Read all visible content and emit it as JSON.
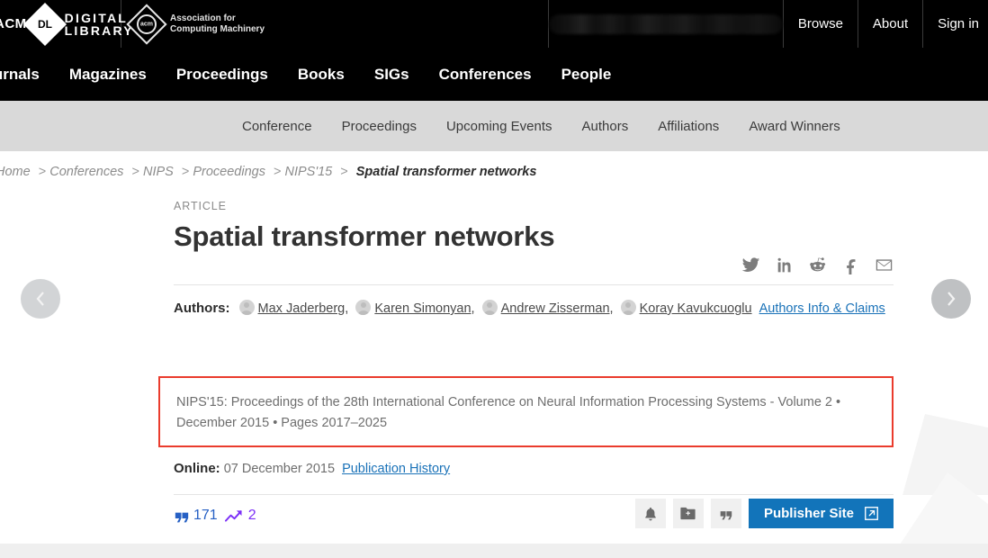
{
  "topbar": {
    "acm_prefix": "ACM",
    "dl_line1": "DIGITAL",
    "dl_line2": "LIBRARY",
    "acm_org_line1": "Association for",
    "acm_org_line2": "Computing Machinery",
    "acm_logo_label": "acm",
    "dl_logo_label": "DL",
    "search_redacted": "",
    "links": [
      {
        "label": "Browse"
      },
      {
        "label": "About"
      },
      {
        "label": "Sign in"
      }
    ]
  },
  "mainnav": {
    "items": [
      {
        "label": "Journals"
      },
      {
        "label": "Magazines"
      },
      {
        "label": "Proceedings"
      },
      {
        "label": "Books"
      },
      {
        "label": "SIGs"
      },
      {
        "label": "Conferences"
      },
      {
        "label": "People"
      }
    ]
  },
  "subnav": {
    "items": [
      {
        "label": "Conference"
      },
      {
        "label": "Proceedings"
      },
      {
        "label": "Upcoming Events"
      },
      {
        "label": "Authors"
      },
      {
        "label": "Affiliations"
      },
      {
        "label": "Award Winners"
      }
    ]
  },
  "breadcrumb": {
    "items": [
      {
        "label": "Home"
      },
      {
        "label": "Conferences"
      },
      {
        "label": "NIPS"
      },
      {
        "label": "Proceedings"
      },
      {
        "label": "NIPS'15"
      }
    ],
    "separator": ">",
    "current": "Spatial transformer networks"
  },
  "article": {
    "kicker": "ARTICLE",
    "title": "Spatial transformer networks",
    "authors_label": "Authors:",
    "authors": [
      {
        "name": "Max Jaderberg",
        "suffix": ","
      },
      {
        "name": "Karen Simonyan",
        "suffix": ","
      },
      {
        "name": "Andrew Zisserman",
        "suffix": ","
      },
      {
        "name": "Koray Kavukcuoglu",
        "suffix": ""
      }
    ],
    "authors_info_link": "Authors Info & Claims",
    "publication_info": "NIPS'15: Proceedings of the 28th International Conference on Neural Information Processing Systems - Volume 2 • December 2015  • Pages 2017–2025",
    "online_label": "Online:",
    "online_date": "07 December 2015",
    "publication_history_link": "Publication History"
  },
  "share": {
    "icons": [
      {
        "name": "twitter-icon"
      },
      {
        "name": "linkedin-icon"
      },
      {
        "name": "reddit-icon"
      },
      {
        "name": "facebook-icon"
      },
      {
        "name": "email-icon"
      }
    ]
  },
  "metrics": {
    "citations": "171",
    "downloads": "2"
  },
  "actions": {
    "alert_label": "alert-bell",
    "save_label": "save-to-binder",
    "cite_label": "cite",
    "publisher_site_label": "Publisher Site"
  },
  "carousel": {
    "prev_label": "Previous article",
    "next_label": "Next article"
  },
  "colors": {
    "accent_blue": "#1274ba",
    "link_blue": "#1a72b8",
    "highlight_red": "#ea3c2d",
    "citation_blue": "#2660c4",
    "trend_purple": "#7b2ff7",
    "subnav_gray": "#d9d9d9",
    "topbar_black": "#000000"
  }
}
